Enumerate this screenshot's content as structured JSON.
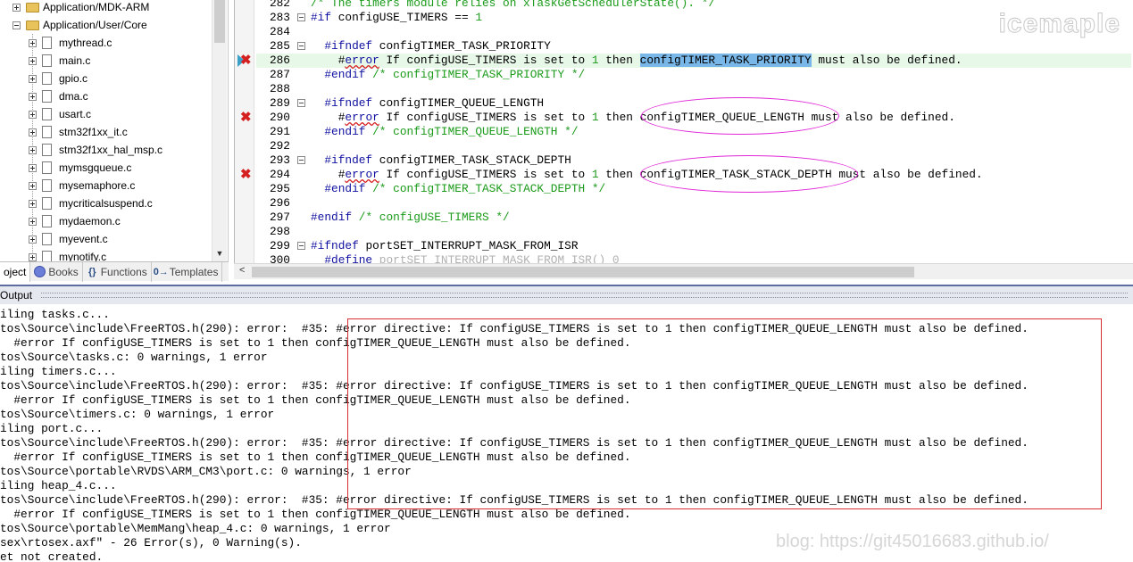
{
  "tree": {
    "folders": [
      {
        "label": "Application/MDK-ARM",
        "expanded": false
      },
      {
        "label": "Application/User/Core",
        "expanded": true
      }
    ],
    "files": [
      "mythread.c",
      "main.c",
      "gpio.c",
      "dma.c",
      "usart.c",
      "stm32f1xx_it.c",
      "stm32f1xx_hal_msp.c",
      "mymsgqueue.c",
      "mysemaphore.c",
      "mycriticalsuspend.c",
      "mydaemon.c",
      "myevent.c",
      "mynotify.c"
    ]
  },
  "panel_tabs": [
    {
      "label": "oject",
      "icon": "project-icon",
      "active": true
    },
    {
      "label": "Books",
      "icon": "books-icon",
      "active": false
    },
    {
      "label": "Functions",
      "icon": "functions-icon",
      "glyph": "{}",
      "active": false
    },
    {
      "label": "Templates",
      "icon": "templates-icon",
      "glyph": "0→",
      "active": false
    }
  ],
  "editor": {
    "watermark": "icemaple",
    "lines": [
      {
        "num": "282",
        "text": "/* The timers module relies on xTaskGetSchedulerState(). */"
      },
      {
        "num": "283",
        "text": "#if configUSE_TIMERS == 1"
      },
      {
        "num": "284",
        "text": ""
      },
      {
        "num": "285",
        "text": "  #ifndef configTIMER_TASK_PRIORITY"
      },
      {
        "num": "286",
        "text": "    #error If configUSE_TIMERS is set to 1 then configTIMER_TASK_PRIORITY must also be defined."
      },
      {
        "num": "287",
        "text": "  #endif /* configTIMER_TASK_PRIORITY */"
      },
      {
        "num": "288",
        "text": ""
      },
      {
        "num": "289",
        "text": "  #ifndef configTIMER_QUEUE_LENGTH"
      },
      {
        "num": "290",
        "text": "    #error If configUSE_TIMERS is set to 1 then configTIMER_QUEUE_LENGTH must also be defined."
      },
      {
        "num": "291",
        "text": "  #endif /* configTIMER_QUEUE_LENGTH */"
      },
      {
        "num": "292",
        "text": ""
      },
      {
        "num": "293",
        "text": "  #ifndef configTIMER_TASK_STACK_DEPTH"
      },
      {
        "num": "294",
        "text": "    #error If configUSE_TIMERS is set to 1 then configTIMER_TASK_STACK_DEPTH must also be defined."
      },
      {
        "num": "295",
        "text": "  #endif /* configTIMER_TASK_STACK_DEPTH */"
      },
      {
        "num": "296",
        "text": ""
      },
      {
        "num": "297",
        "text": "#endif /* configUSE_TIMERS */"
      },
      {
        "num": "298",
        "text": ""
      },
      {
        "num": "299",
        "text": "#ifndef portSET_INTERRUPT_MASK_FROM_ISR"
      },
      {
        "num": "300",
        "text": "  #define portSET_INTERRUPT_MASK_FROM_ISR() 0"
      }
    ],
    "highlighted_identifier": "configTIMER_TASK_PRIORITY",
    "error_marker": "✖"
  },
  "output": {
    "title": "Output",
    "lines": [
      "iling tasks.c...",
      "tos\\Source\\include\\FreeRTOS.h(290): error:  #35: #error directive: If configUSE_TIMERS is set to 1 then configTIMER_QUEUE_LENGTH must also be defined.",
      "  #error If configUSE_TIMERS is set to 1 then configTIMER_QUEUE_LENGTH must also be defined.",
      "tos\\Source\\tasks.c: 0 warnings, 1 error",
      "iling timers.c...",
      "tos\\Source\\include\\FreeRTOS.h(290): error:  #35: #error directive: If configUSE_TIMERS is set to 1 then configTIMER_QUEUE_LENGTH must also be defined.",
      "  #error If configUSE_TIMERS is set to 1 then configTIMER_QUEUE_LENGTH must also be defined.",
      "tos\\Source\\timers.c: 0 warnings, 1 error",
      "iling port.c...",
      "tos\\Source\\include\\FreeRTOS.h(290): error:  #35: #error directive: If configUSE_TIMERS is set to 1 then configTIMER_QUEUE_LENGTH must also be defined.",
      "  #error If configUSE_TIMERS is set to 1 then configTIMER_QUEUE_LENGTH must also be defined.",
      "tos\\Source\\portable\\RVDS\\ARM_CM3\\port.c: 0 warnings, 1 error",
      "iling heap_4.c...",
      "tos\\Source\\include\\FreeRTOS.h(290): error:  #35: #error directive: If configUSE_TIMERS is set to 1 then configTIMER_QUEUE_LENGTH must also be defined.",
      "  #error If configUSE_TIMERS is set to 1 then configTIMER_QUEUE_LENGTH must also be defined.",
      "tos\\Source\\portable\\MemMang\\heap_4.c: 0 warnings, 1 error",
      "sex\\rtosex.axf\" - 26 Error(s), 0 Warning(s).",
      "et not created."
    ],
    "watermark": "blog: https://git45016683.github.io/"
  },
  "colors": {
    "error_red": "#d42020",
    "annotation_magenta": "#e027d8",
    "selection_blue": "#78b7e8",
    "comment_green": "#1a9b1a",
    "keyword_blue": "#1010a0"
  }
}
